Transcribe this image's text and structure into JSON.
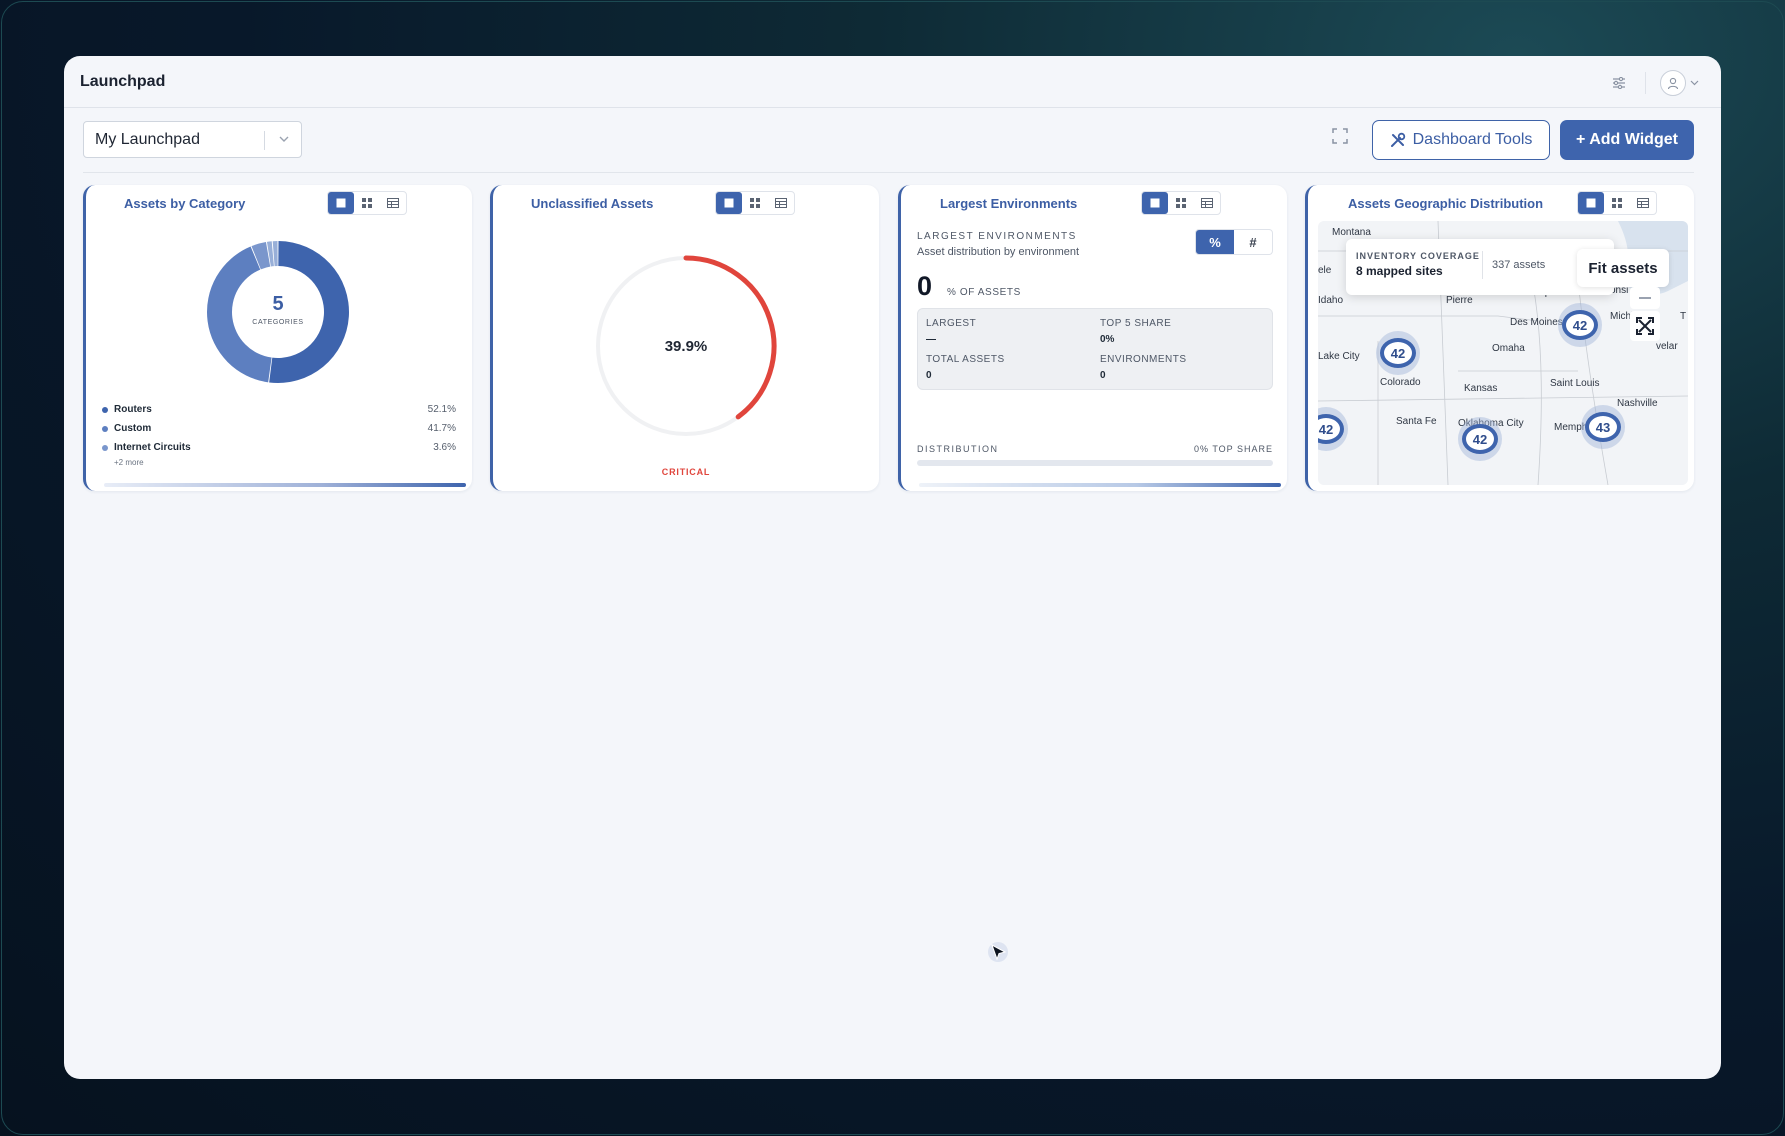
{
  "app": {
    "title": "Launchpad"
  },
  "toolbar": {
    "dashboard_select": "My Launchpad",
    "dashboard_tools_label": "Dashboard Tools",
    "add_widget_label": "+ Add Widget"
  },
  "widgets": {
    "category": {
      "title": "Assets by Category",
      "center_value": "5",
      "center_label": "CATEGORIES",
      "items": [
        {
          "label": "Routers",
          "pct": "52.1%"
        },
        {
          "label": "Custom",
          "pct": "41.7%"
        },
        {
          "label": "Internet Circuits",
          "pct": "3.6%"
        }
      ],
      "more": "+2 more",
      "colors": [
        "#3e64ad",
        "#5d7fc0",
        "#7a96cc",
        "#98afd8"
      ]
    },
    "unclassified": {
      "title": "Unclassified Assets",
      "value": "39.9%",
      "fraction": 0.399,
      "status": "CRITICAL",
      "status_color": "#e0453c"
    },
    "environments": {
      "title": "Largest Environments",
      "section_label": "LARGEST ENVIRONMENTS",
      "subtitle": "Asset distribution by environment",
      "toggle_pct": "%",
      "toggle_count": "#",
      "big_value": "0",
      "big_unit": "% OF ASSETS",
      "stats": {
        "largest_label": "LARGEST",
        "largest_value": "—",
        "top5_label": "TOP 5 SHARE",
        "top5_value": "0%",
        "total_label": "TOTAL ASSETS",
        "total_value": "0",
        "envs_label": "ENVIRONMENTS",
        "envs_value": "0"
      },
      "distribution_label": "DISTRIBUTION",
      "distribution_right": "0% TOP SHARE"
    },
    "geo": {
      "title": "Assets Geographic Distribution",
      "coverage_label": "INVENTORY COVERAGE",
      "coverage_value": "8 mapped sites",
      "assets_count": "337 assets",
      "fit_label": "Fit assets",
      "cities": {
        "montana": "Montana",
        "ele": "ele",
        "idaho": "Idaho",
        "pierre": "Pierre",
        "minneapolis": "Minneapolis",
        "wiscons": "sconsi",
        "michigan": "Michigan",
        "t": "T",
        "des_moines": "Des Moines",
        "cleveland": "velar",
        "lake_city": "Lake City",
        "omaha": "Omaha",
        "colorado": "Colorado",
        "kansas": "Kansas",
        "saint_louis": "Saint Louis",
        "nashville": "Nashville",
        "santa_fe": "Santa Fe",
        "oklahoma_city": "Oklahoma City",
        "memphis": "Memphis"
      },
      "clusters": [
        "42",
        "42",
        "42",
        "42",
        "43"
      ]
    }
  }
}
